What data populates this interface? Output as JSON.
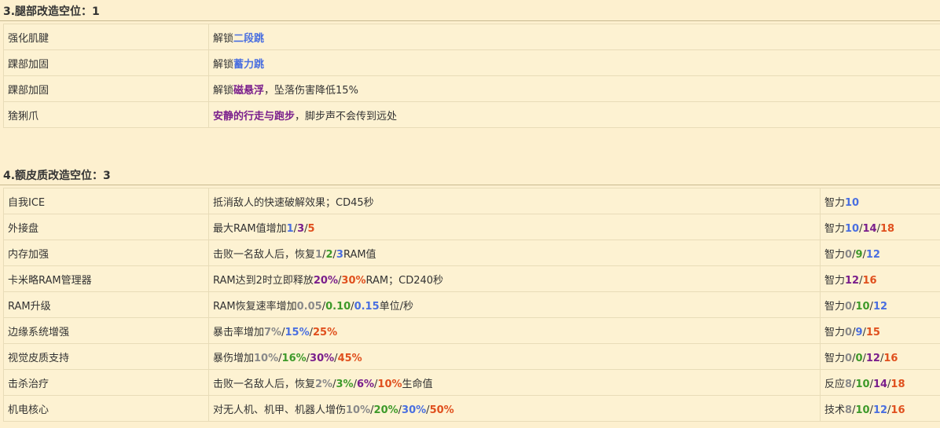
{
  "sections": [
    {
      "title": "3.腿部改造空位：1",
      "rows": [
        {
          "name": "强化肌腱",
          "desc": [
            {
              "t": "解锁"
            },
            {
              "t": "二段跳",
              "c": "blue"
            }
          ]
        },
        {
          "name": "踝部加固",
          "desc": [
            {
              "t": "解锁"
            },
            {
              "t": "蓄力跳",
              "c": "blue"
            }
          ]
        },
        {
          "name": "踝部加固",
          "desc": [
            {
              "t": "解锁"
            },
            {
              "t": "磁悬浮",
              "c": "purple"
            },
            {
              "t": "，坠落伤害降低15%"
            }
          ]
        },
        {
          "name": "猞猁爪",
          "desc": [
            {
              "t": "安静的行走与跑步",
              "c": "purple"
            },
            {
              "t": "，脚步声不会传到远处"
            }
          ]
        }
      ]
    },
    {
      "title": "4.额皮质改造空位：3",
      "rows": [
        {
          "name": "自我ICE",
          "desc": [
            {
              "t": "抵消敌人的快速破解效果；CD45秒"
            }
          ],
          "req": [
            {
              "t": "智力"
            },
            {
              "t": "10",
              "c": "blue"
            }
          ]
        },
        {
          "name": "外接盘",
          "desc": [
            {
              "t": "最大RAM值增加"
            },
            {
              "t": "1",
              "c": "blue"
            },
            {
              "t": "/"
            },
            {
              "t": "3",
              "c": "purple"
            },
            {
              "t": "/"
            },
            {
              "t": "5",
              "c": "orange"
            }
          ],
          "req": [
            {
              "t": "智力"
            },
            {
              "t": "10",
              "c": "blue"
            },
            {
              "t": "/"
            },
            {
              "t": "14",
              "c": "purple"
            },
            {
              "t": "/"
            },
            {
              "t": "18",
              "c": "orange"
            }
          ]
        },
        {
          "name": "内存加强",
          "desc": [
            {
              "t": "击败一名敌人后，恢复"
            },
            {
              "t": "1",
              "c": "gray"
            },
            {
              "t": "/"
            },
            {
              "t": "2",
              "c": "green"
            },
            {
              "t": "/"
            },
            {
              "t": "3",
              "c": "blue"
            },
            {
              "t": "RAM值"
            }
          ],
          "req": [
            {
              "t": "智力"
            },
            {
              "t": "0",
              "c": "gray"
            },
            {
              "t": "/"
            },
            {
              "t": "9",
              "c": "green"
            },
            {
              "t": "/"
            },
            {
              "t": "12",
              "c": "blue"
            }
          ]
        },
        {
          "name": "卡米略RAM管理器",
          "desc": [
            {
              "t": "RAM达到2时立即释放"
            },
            {
              "t": "20%",
              "c": "purple"
            },
            {
              "t": "/"
            },
            {
              "t": "30%",
              "c": "orange"
            },
            {
              "t": "RAM；CD240秒"
            }
          ],
          "req": [
            {
              "t": "智力"
            },
            {
              "t": "12",
              "c": "purple"
            },
            {
              "t": "/"
            },
            {
              "t": "16",
              "c": "orange"
            }
          ]
        },
        {
          "name": "RAM升级",
          "desc": [
            {
              "t": "RAM恢复速率增加"
            },
            {
              "t": "0.05",
              "c": "gray"
            },
            {
              "t": "/"
            },
            {
              "t": "0.10",
              "c": "green"
            },
            {
              "t": "/"
            },
            {
              "t": "0.15",
              "c": "blue"
            },
            {
              "t": "单位/秒"
            }
          ],
          "req": [
            {
              "t": "智力"
            },
            {
              "t": "0",
              "c": "gray"
            },
            {
              "t": "/"
            },
            {
              "t": "10",
              "c": "green"
            },
            {
              "t": "/"
            },
            {
              "t": "12",
              "c": "blue"
            }
          ]
        },
        {
          "name": "边缘系统增强",
          "desc": [
            {
              "t": "暴击率增加"
            },
            {
              "t": "7%",
              "c": "gray"
            },
            {
              "t": "/"
            },
            {
              "t": "15%",
              "c": "blue"
            },
            {
              "t": "/"
            },
            {
              "t": "25%",
              "c": "orange"
            }
          ],
          "req": [
            {
              "t": "智力"
            },
            {
              "t": "0",
              "c": "gray"
            },
            {
              "t": "/"
            },
            {
              "t": "9",
              "c": "blue"
            },
            {
              "t": "/"
            },
            {
              "t": "15",
              "c": "orange"
            }
          ]
        },
        {
          "name": "视觉皮质支持",
          "desc": [
            {
              "t": "暴伤增加"
            },
            {
              "t": "10%",
              "c": "gray"
            },
            {
              "t": "/"
            },
            {
              "t": "16%",
              "c": "green"
            },
            {
              "t": "/"
            },
            {
              "t": "30%",
              "c": "purple"
            },
            {
              "t": "/"
            },
            {
              "t": "45%",
              "c": "orange"
            }
          ],
          "req": [
            {
              "t": "智力"
            },
            {
              "t": "0",
              "c": "gray"
            },
            {
              "t": "/"
            },
            {
              "t": "0",
              "c": "green"
            },
            {
              "t": "/"
            },
            {
              "t": "12",
              "c": "purple"
            },
            {
              "t": "/"
            },
            {
              "t": "16",
              "c": "orange"
            }
          ]
        },
        {
          "name": "击杀治疗",
          "desc": [
            {
              "t": "击败一名敌人后，恢复"
            },
            {
              "t": "2%",
              "c": "gray"
            },
            {
              "t": "/"
            },
            {
              "t": "3%",
              "c": "green"
            },
            {
              "t": "/"
            },
            {
              "t": "6%",
              "c": "purple"
            },
            {
              "t": "/"
            },
            {
              "t": "10%",
              "c": "orange"
            },
            {
              "t": "生命值"
            }
          ],
          "req": [
            {
              "t": "反应"
            },
            {
              "t": "8",
              "c": "gray"
            },
            {
              "t": "/"
            },
            {
              "t": "10",
              "c": "green"
            },
            {
              "t": "/"
            },
            {
              "t": "14",
              "c": "purple"
            },
            {
              "t": "/"
            },
            {
              "t": "18",
              "c": "orange"
            }
          ]
        },
        {
          "name": "机电核心",
          "desc": [
            {
              "t": "对无人机、机甲、机器人增伤"
            },
            {
              "t": "10%",
              "c": "gray"
            },
            {
              "t": "/"
            },
            {
              "t": "20%",
              "c": "green"
            },
            {
              "t": "/"
            },
            {
              "t": "30%",
              "c": "blue"
            },
            {
              "t": "/"
            },
            {
              "t": "50%",
              "c": "orange"
            }
          ],
          "req": [
            {
              "t": "技术"
            },
            {
              "t": "8",
              "c": "gray"
            },
            {
              "t": "/"
            },
            {
              "t": "10",
              "c": "green"
            },
            {
              "t": "/"
            },
            {
              "t": "12",
              "c": "blue"
            },
            {
              "t": "/"
            },
            {
              "t": "16",
              "c": "orange"
            }
          ]
        }
      ]
    }
  ],
  "colors": {
    "blue": "#4a6fe0",
    "purple": "#7a1f8c",
    "orange": "#e0501e",
    "green": "#3e9a2a",
    "gray": "#8a8a8a"
  }
}
